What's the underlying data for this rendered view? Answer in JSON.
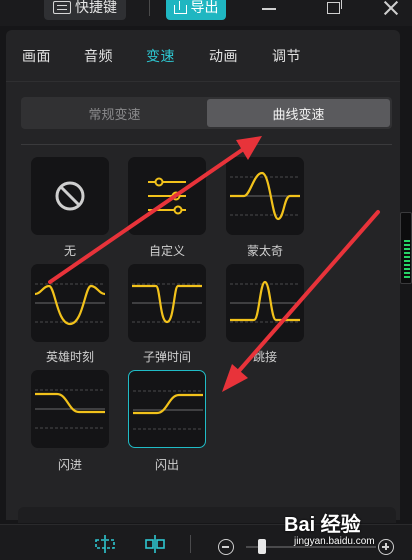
{
  "toolbar": {
    "shortcut_label": "快捷键",
    "export_label": "导出"
  },
  "tabs": [
    {
      "label": "画面"
    },
    {
      "label": "音频"
    },
    {
      "label": "变速"
    },
    {
      "label": "动画"
    },
    {
      "label": "调节"
    }
  ],
  "active_tab": "变速",
  "speed_mode": {
    "normal": "常规变速",
    "curve": "曲线变速",
    "selected": "曲线变速"
  },
  "presets": [
    {
      "label": "无",
      "icon": "none-icon"
    },
    {
      "label": "自定义",
      "icon": "sliders-icon"
    },
    {
      "label": "蒙太奇",
      "icon": "montage-curve-icon"
    },
    {
      "label": "英雄时刻",
      "icon": "hero-moment-curve-icon"
    },
    {
      "label": "子弹时间",
      "icon": "bullet-time-curve-icon"
    },
    {
      "label": "跳接",
      "icon": "jump-cut-curve-icon"
    },
    {
      "label": "闪进",
      "icon": "flash-in-curve-icon"
    },
    {
      "label": "闪出",
      "icon": "flash-out-curve-icon"
    }
  ],
  "selected_preset": "闪出",
  "colors": {
    "accent": "#1fb6c1",
    "curve": "#f2c21b",
    "annotation_arrow": "#e8333a",
    "panel": "#242426"
  },
  "watermark": {
    "logo": "Bai 经验",
    "url": "jingyan.baidu.com"
  }
}
